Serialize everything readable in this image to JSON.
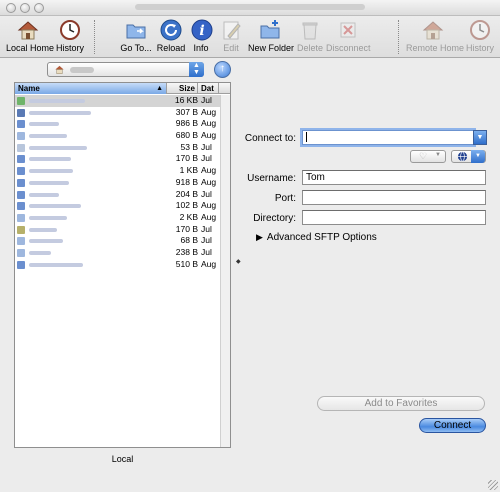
{
  "toolbar": {
    "items": [
      {
        "label": "Local Home",
        "enabled": true,
        "icon": "house-icon"
      },
      {
        "label": "History",
        "enabled": true,
        "icon": "clock-icon"
      },
      {
        "label": "Go To...",
        "enabled": true,
        "icon": "folder-icon"
      },
      {
        "label": "Reload",
        "enabled": true,
        "icon": "reload-icon"
      },
      {
        "label": "Info",
        "enabled": true,
        "icon": "info-icon"
      },
      {
        "label": "Edit",
        "enabled": false,
        "icon": "edit-icon"
      },
      {
        "label": "New Folder",
        "enabled": true,
        "icon": "new-folder-icon"
      },
      {
        "label": "Delete",
        "enabled": false,
        "icon": "delete-icon"
      },
      {
        "label": "Disconnect",
        "enabled": false,
        "icon": "disconnect-icon"
      },
      {
        "label": "Remote Home",
        "enabled": false,
        "icon": "house-icon"
      },
      {
        "label": "History",
        "enabled": false,
        "icon": "clock-icon"
      }
    ]
  },
  "browser": {
    "columns": {
      "name": "Name",
      "size": "Size",
      "date": "Dat"
    },
    "rows": [
      {
        "size": "16 KB",
        "date": "Jul",
        "selected": true,
        "icon_color": "#6fb46a"
      },
      {
        "size": "307 B",
        "date": "Aug",
        "selected": false,
        "icon_color": "#5a7ab5"
      },
      {
        "size": "986 B",
        "date": "Aug",
        "selected": false,
        "icon_color": "#6b8fcf"
      },
      {
        "size": "680 B",
        "date": "Aug",
        "selected": false,
        "icon_color": "#9eb7de"
      },
      {
        "size": "53 B",
        "date": "Jul",
        "selected": false,
        "icon_color": "#b8c6dc"
      },
      {
        "size": "170 B",
        "date": "Jul",
        "selected": false,
        "icon_color": "#6b8fcf"
      },
      {
        "size": "1 KB",
        "date": "Aug",
        "selected": false,
        "icon_color": "#6b8fcf"
      },
      {
        "size": "918 B",
        "date": "Aug",
        "selected": false,
        "icon_color": "#6b8fcf"
      },
      {
        "size": "204 B",
        "date": "Jul",
        "selected": false,
        "icon_color": "#6b8fcf"
      },
      {
        "size": "102 B",
        "date": "Aug",
        "selected": false,
        "icon_color": "#6b8fcf"
      },
      {
        "size": "2 KB",
        "date": "Aug",
        "selected": false,
        "icon_color": "#9eb7de"
      },
      {
        "size": "170 B",
        "date": "Jul",
        "selected": false,
        "icon_color": "#b6b06a"
      },
      {
        "size": "68 B",
        "date": "Jul",
        "selected": false,
        "icon_color": "#9eb7de"
      },
      {
        "size": "238 B",
        "date": "Jul",
        "selected": false,
        "icon_color": "#9eb7de"
      },
      {
        "size": "510 B",
        "date": "Aug",
        "selected": false,
        "icon_color": "#6b8fcf"
      }
    ],
    "footer_label": "Local"
  },
  "connect": {
    "connect_to_label": "Connect to:",
    "connect_to_value": "",
    "username_label": "Username:",
    "username_value": "Tom",
    "port_label": "Port:",
    "port_value": "",
    "directory_label": "Directory:",
    "directory_value": "",
    "advanced_label": "Advanced SFTP Options",
    "add_favorites_label": "Add to Favorites",
    "connect_button_label": "Connect"
  }
}
